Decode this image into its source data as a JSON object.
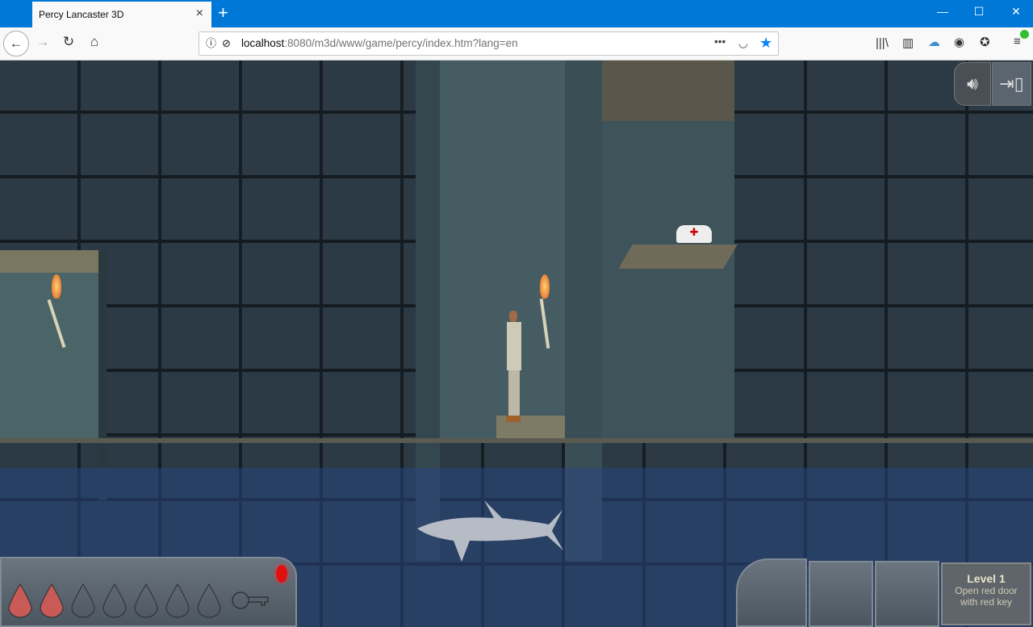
{
  "browser": {
    "tab_title": "Percy Lancaster 3D",
    "tab_close": "×",
    "new_tab": "+",
    "window_controls": [
      "—",
      "☐",
      "✕"
    ],
    "url_host": "localhost",
    "url_rest": ":8080/m3d/www/game/percy/index.htm?lang=en",
    "icons": [
      "back-icon",
      "forward-icon",
      "reload-icon",
      "home-icon",
      "info-icon",
      "tracking-icon",
      "more-icon",
      "pocket-icon",
      "bookmark-star-icon",
      "library-icon",
      "sidebar-icon",
      "cloud-upload-icon",
      "account-icon",
      "extension-icon",
      "menu-icon"
    ],
    "accent": "#0078d7"
  },
  "game": {
    "hud": {
      "health_total": 7,
      "health_filled": 2,
      "key_collected": false,
      "level_title": "Level 1",
      "objective": "Open red door with red key"
    },
    "buttons": {
      "sound": "sound-icon",
      "exit": "exit-door-icon"
    }
  }
}
